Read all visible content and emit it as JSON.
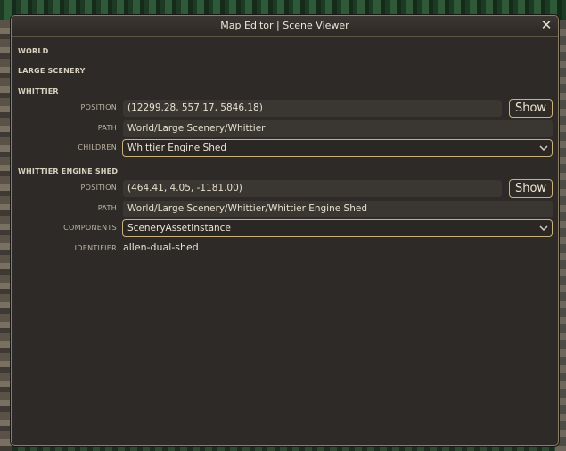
{
  "window": {
    "title": "Map Editor | Scene Viewer"
  },
  "tree": {
    "world": "WORLD",
    "large_scenery": "LARGE SCENERY",
    "whittier": {
      "header": "WHITTIER",
      "position_label": "POSITION",
      "position_value": "(12299.28, 557.17, 5846.18)",
      "show_label": "Show",
      "path_label": "PATH",
      "path_value": "World/Large Scenery/Whittier",
      "children_label": "CHILDREN",
      "children_selected": "Whittier Engine Shed"
    },
    "engine_shed": {
      "header": "WHITTIER ENGINE SHED",
      "position_label": "POSITION",
      "position_value": "(464.41, 4.05, -1181.00)",
      "show_label": "Show",
      "path_label": "PATH",
      "path_value": "World/Large Scenery/Whittier/Whittier Engine Shed",
      "components_label": "COMPONENTS",
      "components_selected": "SceneryAssetInstance",
      "identifier_label": "IDENTIFIER",
      "identifier_value": "allen-dual-shed"
    }
  },
  "icons": {
    "close": "close-icon",
    "dropdown": "chevron-down-icon"
  },
  "colors": {
    "accent": "#cbb27a",
    "panel": "#2d2a27",
    "field": "#3a3632"
  }
}
